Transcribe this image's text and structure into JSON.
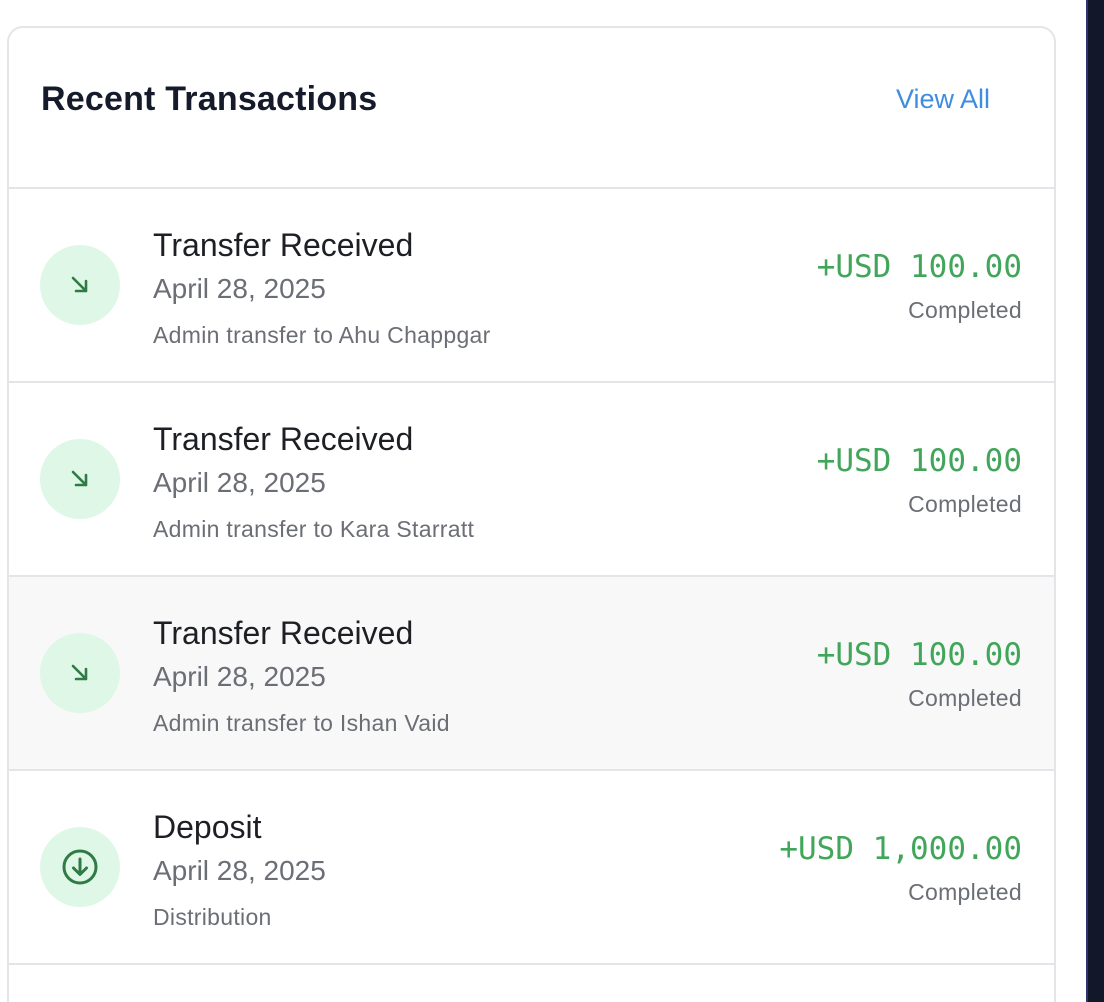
{
  "card": {
    "title": "Recent Transactions",
    "view_all_label": "View All"
  },
  "transactions": [
    {
      "title": "Transfer Received",
      "date": "April 28, 2025",
      "description": "Admin transfer to Ahu Chappgar",
      "amount": "+USD 100.00",
      "status": "Completed",
      "icon": "arrow-down-right-icon"
    },
    {
      "title": "Transfer Received",
      "date": "April 28, 2025",
      "description": "Admin transfer to Kara Starratt",
      "amount": "+USD 100.00",
      "status": "Completed",
      "icon": "arrow-down-right-icon"
    },
    {
      "title": "Transfer Received",
      "date": "April 28, 2025",
      "description": "Admin transfer to Ishan Vaid",
      "amount": "+USD 100.00",
      "status": "Completed",
      "icon": "arrow-down-right-icon"
    },
    {
      "title": "Deposit",
      "date": "April 28, 2025",
      "description": "Distribution",
      "amount": "+USD 1,000.00",
      "status": "Completed",
      "icon": "arrow-down-circle-icon"
    }
  ],
  "colors": {
    "accent_link": "#3d8de0",
    "amount_positive": "#41a65a",
    "icon_background": "#dff7e6",
    "icon_foreground": "#2f7a45"
  }
}
